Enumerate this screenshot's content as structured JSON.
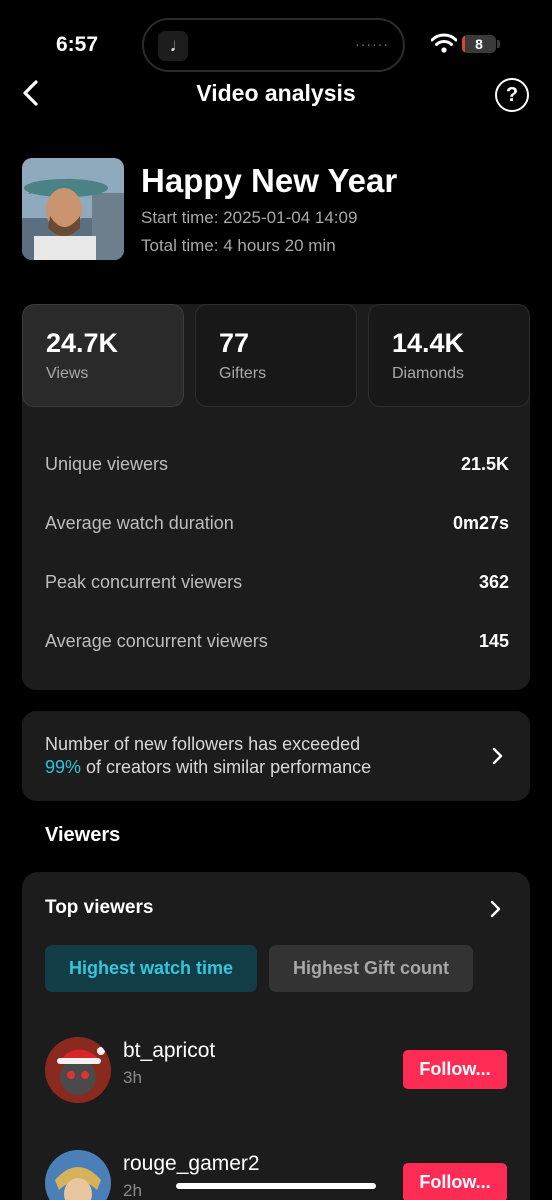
{
  "status_bar": {
    "time": "6:57",
    "island_app_glyph": "𝅘𝅥",
    "island_dots": "······",
    "battery_level": "8",
    "battery_fraction": 0.08
  },
  "header": {
    "title": "Video analysis",
    "back_icon": "chevron-left-icon",
    "help_icon": "question-circle-icon",
    "help_glyph": "?"
  },
  "video": {
    "title": "Happy New Year",
    "start_time": "Start time: 2025-01-04 14:09",
    "total_time": "Total time: 4 hours 20 min"
  },
  "stats": {
    "tiles": [
      {
        "value": "24.7K",
        "label": "Views"
      },
      {
        "value": "77",
        "label": "Gifters"
      },
      {
        "value": "14.4K",
        "label": "Diamonds"
      }
    ],
    "metrics": [
      {
        "label": "Unique viewers",
        "value": "21.5K"
      },
      {
        "label": "Average watch duration",
        "value": "0m27s"
      },
      {
        "label": "Peak concurrent viewers",
        "value": "362"
      },
      {
        "label": "Average concurrent viewers",
        "value": "145"
      }
    ]
  },
  "followers_banner": {
    "line1": "Number of new followers has exceeded",
    "percent": "99%",
    "line2_rest": " of creators with similar performance"
  },
  "viewers_section": {
    "title": "Viewers",
    "card_title": "Top viewers",
    "tabs": [
      "Highest watch time",
      "Highest Gift count"
    ],
    "list": [
      {
        "name": "bt_apricot",
        "sub": "3h",
        "button": "Follow..."
      },
      {
        "name": "rouge_gamer2",
        "sub": "2h",
        "button": "Follow..."
      }
    ]
  },
  "colors": {
    "accent": "#2bc3db",
    "follow": "#fe2c55",
    "card": "#1c1c1c",
    "battery_low": "#e0403a"
  }
}
